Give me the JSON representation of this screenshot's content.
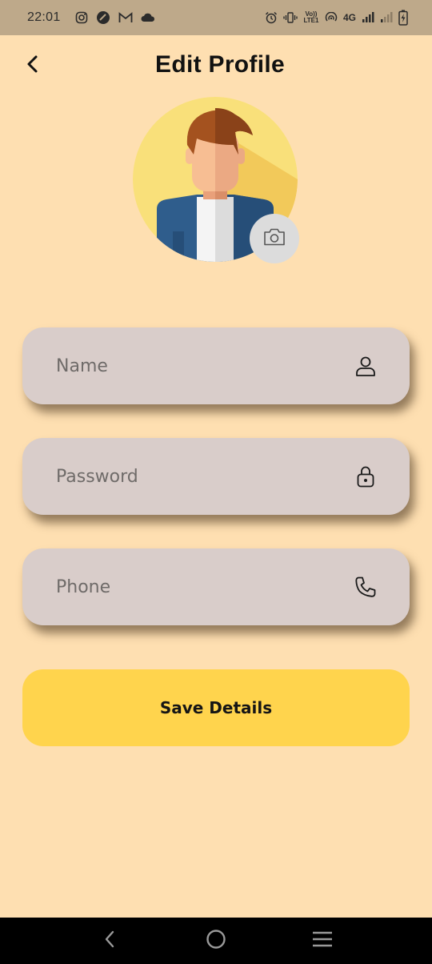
{
  "status_bar": {
    "time": "22:01",
    "network": "4G",
    "volte": "Vo)) LTE1",
    "left_icons": [
      "instagram-icon",
      "app-icon",
      "gmail-icon",
      "cloud-icon"
    ],
    "right_icons": [
      "alarm-icon",
      "vibrate-icon",
      "volte-icon",
      "hotspot-icon",
      "signal-4g-icon",
      "signal-icon",
      "battery-charging-icon"
    ]
  },
  "header": {
    "title": "Edit Profile",
    "back_icon": "chevron-left-icon"
  },
  "profile": {
    "camera_icon": "camera-icon"
  },
  "form": {
    "name": {
      "placeholder": "Name",
      "value": "",
      "icon": "user-icon"
    },
    "password": {
      "placeholder": "Password",
      "value": "",
      "icon": "lock-icon"
    },
    "phone": {
      "placeholder": "Phone",
      "value": "",
      "icon": "phone-icon"
    }
  },
  "save_button": {
    "label": "Save Details"
  },
  "nav_bar": {
    "back_icon": "nav-back-icon",
    "home_icon": "nav-home-icon",
    "recents_icon": "nav-recents-icon"
  },
  "colors": {
    "background": "#FEDFB1",
    "status_bar": "#BEA98A",
    "field": "#D9CDCA",
    "save_button": "#FFD44D",
    "camera_button": "#DCDCDC",
    "nav_bar": "#000000"
  }
}
